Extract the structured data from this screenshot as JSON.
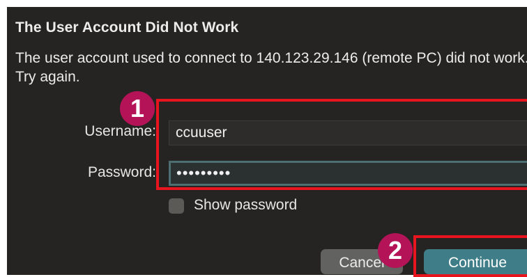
{
  "dialog": {
    "title": "The User Account Did Not Work",
    "message": "The user account used to connect to 140.123.29.146 (remote PC) did not work. Try again."
  },
  "form": {
    "username_label": "Username:",
    "username_value": "ccuuser",
    "password_label": "Password:",
    "password_value": "•••••••••",
    "show_password_label": "Show password",
    "show_password_checked": false
  },
  "buttons": {
    "cancel_label": "Cancel",
    "continue_label": "Continue"
  },
  "annotations": {
    "badge_1": "1",
    "badge_2": "2",
    "highlight_color": "#e8151f",
    "badge_color": "#b41457"
  },
  "colors": {
    "dialog_bg": "#252422",
    "accent": "#3f7e88"
  }
}
